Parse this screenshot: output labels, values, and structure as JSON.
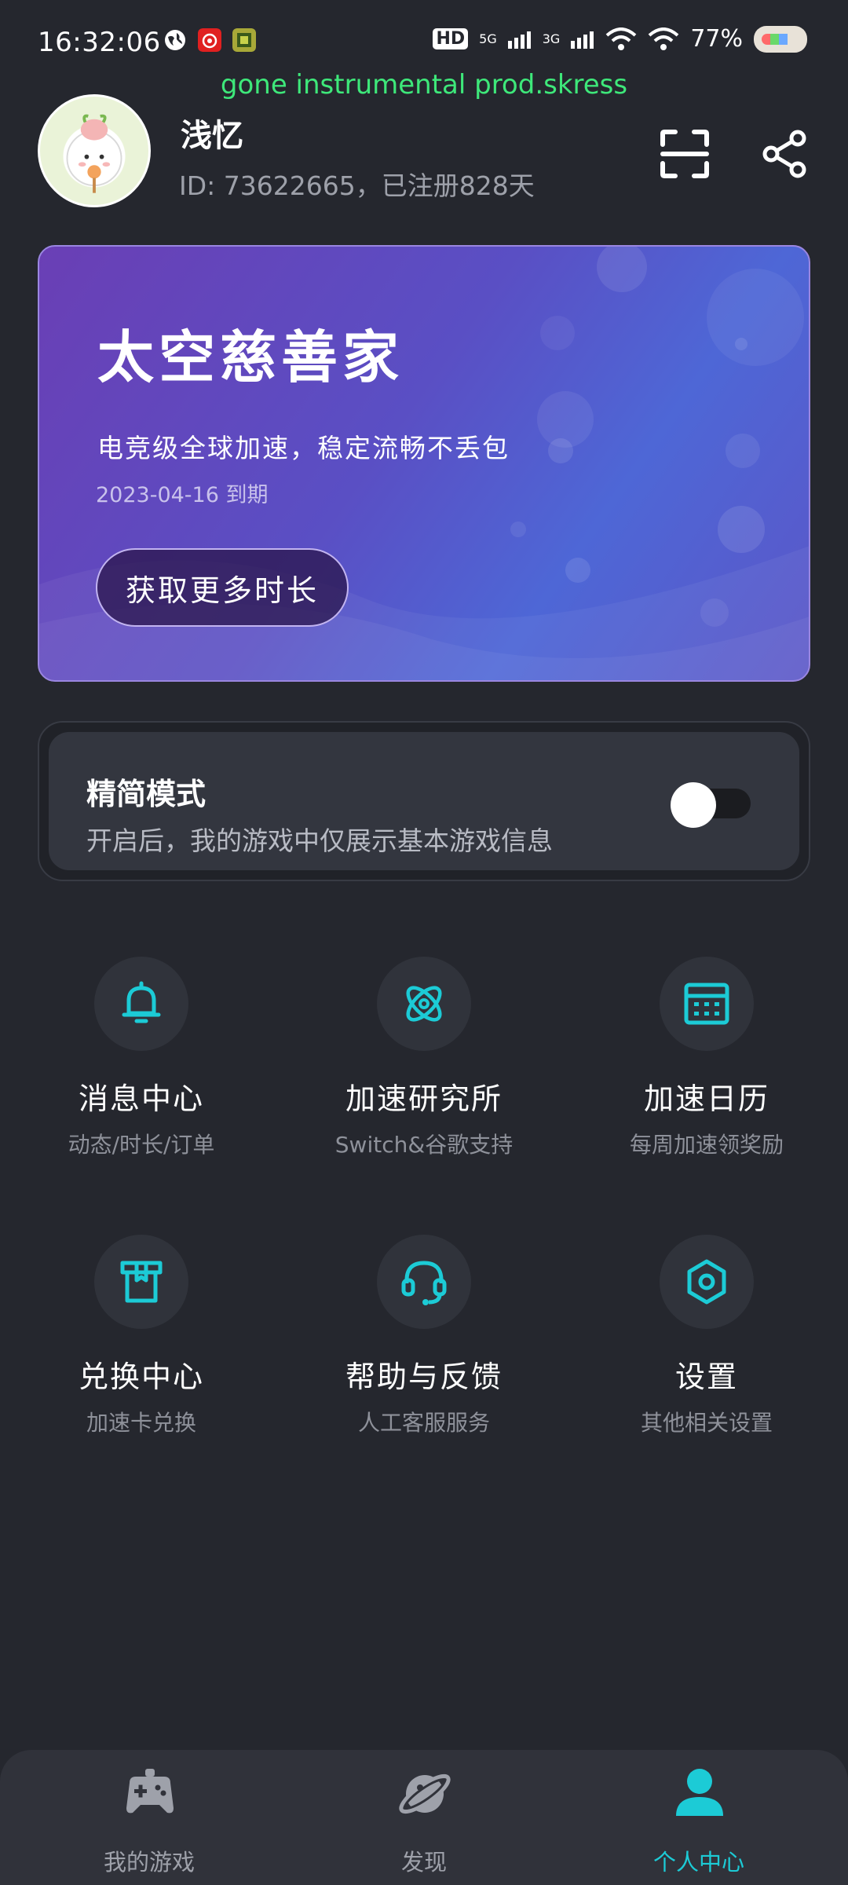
{
  "status_bar": {
    "time": "16:32:06",
    "hd": "HD",
    "sig1": "5G",
    "sig2": "3G",
    "battery": "77%"
  },
  "now_playing": "gone instrumental prod.skress",
  "profile": {
    "name": "浅忆",
    "id_line": "ID: 73622665，已注册828天",
    "icons": [
      "scan-icon",
      "share-icon"
    ]
  },
  "vip_card": {
    "title": "太空慈善家",
    "description": "电竞级全球加速，稳定流畅不丢包",
    "expire": "2023-04-16 到期",
    "button": "获取更多时长"
  },
  "simple_mode": {
    "title": "精简模式",
    "description": "开启后，我的游戏中仅展示基本游戏信息",
    "enabled": false
  },
  "grid": [
    {
      "title": "消息中心",
      "subtitle": "动态/时长/订单",
      "icon": "bell-icon"
    },
    {
      "title": "加速研究所",
      "subtitle": "Switch&谷歌支持",
      "icon": "atom-icon"
    },
    {
      "title": "加速日历",
      "subtitle": "每周加速领奖励",
      "icon": "calendar-icon"
    },
    {
      "title": "兑换中心",
      "subtitle": "加速卡兑换",
      "icon": "gift-box-icon"
    },
    {
      "title": "帮助与反馈",
      "subtitle": "人工客服服务",
      "icon": "headset-icon"
    },
    {
      "title": "设置",
      "subtitle": "其他相关设置",
      "icon": "settings-icon"
    }
  ],
  "bottom_nav": [
    {
      "label": "我的游戏",
      "icon": "gamepad-icon",
      "active": false
    },
    {
      "label": "发现",
      "icon": "planet-icon",
      "active": false
    },
    {
      "label": "个人中心",
      "icon": "person-icon",
      "active": true
    }
  ],
  "colors": {
    "background": "#25272e",
    "accent": "#1ccbd6",
    "lyric": "#3ee87a",
    "card_purple": "#6a3fb5",
    "card_blue": "#4e67d6"
  }
}
